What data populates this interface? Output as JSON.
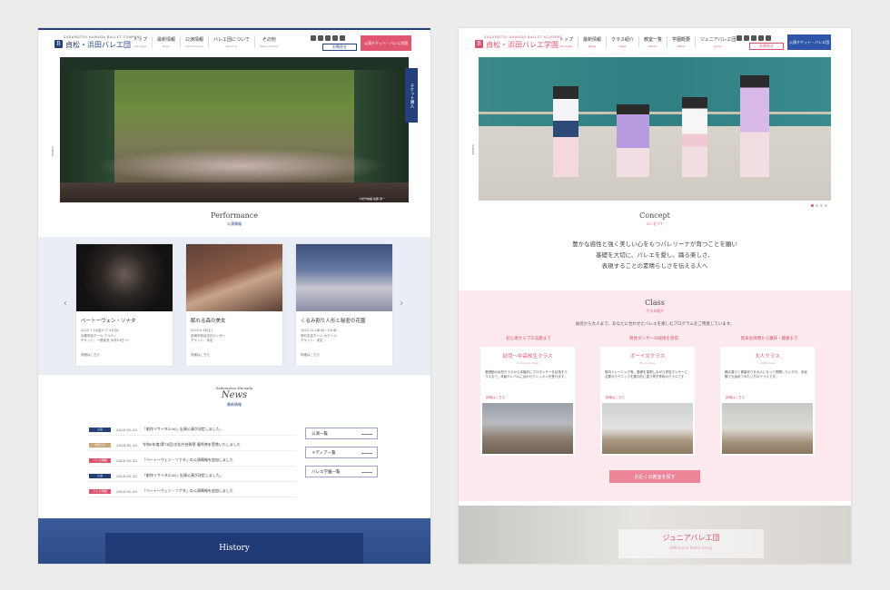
{
  "left": {
    "logo": {
      "en": "SADAMATSU HAMADA BALLET COMPANY",
      "jp": "貞松・浜田バレエ団",
      "mark": "B",
      "color": "#24407a"
    },
    "nav": [
      {
        "jp": "トップ",
        "en": "Top page"
      },
      {
        "jp": "最新情報",
        "en": "News"
      },
      {
        "jp": "公演情報",
        "en": "Performance"
      },
      {
        "jp": "バレエ団について",
        "en": "About us"
      },
      {
        "jp": "その他",
        "en": "Other Activity"
      }
    ],
    "contact_label": "お問合せ",
    "ticket_label": "公演チケット・バレエ学園",
    "ticket_tab": "チケット購入",
    "scroll_label": "SCROLL",
    "hero_caption": "©松竹映画 佐藤 研一",
    "performance": {
      "en": "Performance",
      "jp": "公演情報"
    },
    "cards": [
      {
        "title": "ベートーヴェン・ソナタ",
        "meta": [
          "2025.7.18(金)〜7.21(月)",
          "京都府民ホール アルティ",
          "チケット：一般前売 (6月10日〜)"
        ],
        "more": "詳細はこちら"
      },
      {
        "title": "眠れる森の美女",
        "meta": [
          "2025.6.14(土)",
          "尼崎市総合文化センター",
          "チケット：未定"
        ],
        "more": "詳細はこちら"
      },
      {
        "title": "くるみ割り人形と秘密の花園",
        "meta": [
          "2025.12.24(水)〜25(木)",
          "神戸文化ホール 大ホール",
          "チケット：未定"
        ],
        "more": "詳細はこちら"
      }
    ],
    "news": {
      "small": "Sadamatsu Hamada",
      "en": "News",
      "jp": "最新情報",
      "rows": [
        {
          "badge": "公演",
          "color": "#24407a",
          "date": "2025.02.25",
          "text": "「創作リサイタル36」出演公演が決定しました。"
        },
        {
          "badge": "お知らせ",
          "color": "#c7a77a",
          "date": "2025.02.25",
          "text": "令和6年度(第74回)文化庁芸術祭 優秀賞を受賞いたしました"
        },
        {
          "badge": "バレエ学園",
          "color": "#d9536f",
          "date": "2025.02.25",
          "text": "「ベートーヴェン・ソナタ」の公演情報を追加しました"
        },
        {
          "badge": "公演",
          "color": "#24407a",
          "date": "2025.02.25",
          "text": "「創作リサイタル36」出演公演が決定しました。"
        },
        {
          "badge": "バレエ学園",
          "color": "#d9536f",
          "date": "2025.02.25",
          "text": "「ベートーヴェン・ソナタ」の公演情報を追加しました"
        }
      ],
      "side_buttons": [
        "公演一覧",
        "メディア一覧",
        "バレエ学園一覧"
      ]
    },
    "history": "History"
  },
  "right": {
    "logo": {
      "en": "SADAMATSU HAMADA BALLET ACADEMY",
      "jp": "貞松・浜田バレエ学園",
      "mark": "B",
      "color": "#d9536f"
    },
    "nav": [
      {
        "jp": "トップ",
        "en": "Top page"
      },
      {
        "jp": "最新情報",
        "en": "News"
      },
      {
        "jp": "クラス紹介",
        "en": "Class"
      },
      {
        "jp": "教室一覧",
        "en": "Studio"
      },
      {
        "jp": "学園概要",
        "en": "About"
      },
      {
        "jp": "ジュニアバレエ団",
        "en": "Junior"
      }
    ],
    "contact_label": "お問合せ",
    "ticket_label": "公演チケット・バレエ団",
    "scroll_label": "SCROLL",
    "concept": {
      "en": "Concept",
      "jp": "コンセプト",
      "lines": [
        "豊かな感性と強く美しい心をもつバレリーナが育つことを願い",
        "基礎を大切に、バレエを愛し、踊る楽しさ、",
        "表現することの素晴らしさを伝える人へ"
      ]
    },
    "class": {
      "en": "Class",
      "jp": "クラス紹介",
      "lead": "幼児から大人まで、あなたに合わせたバレエを楽しむプログラムをご用意しています。",
      "labels": [
        "初心者からプロ志願まで",
        "男性ダンサーの技術を習得",
        "発表会目標から趣味・健康まで"
      ],
      "cards": [
        {
          "title": "幼児〜中高校生クラス",
          "sub": "Children's Class",
          "desc": "基礎動の幼児クラスから本格的にプロダンサーを目指すクラスまで、年齢やレベルに合わせてレッスンを受けます。",
          "more": "詳細はこちら"
        },
        {
          "title": "ボーイズクラス",
          "sub": "Boy's Class",
          "desc": "筋肉トレーニング等、基礎を重視しながら男性ダンサーに必要なテクニックを集中的に習う男子専用のクラスです。",
          "more": "詳細はこちら"
        },
        {
          "title": "大人クラス",
          "sub": "Adult Class",
          "desc": "踊る喜びと健康作りを大人になって再開したい方や、未経験でも始めてみたい方のクラスです。",
          "more": "詳細はこちら"
        }
      ],
      "search_button": "お近くの教室を探す"
    },
    "junior": {
      "jp": "ジュニアバレエ団",
      "en": "SHB Junior Ballet Group"
    }
  }
}
